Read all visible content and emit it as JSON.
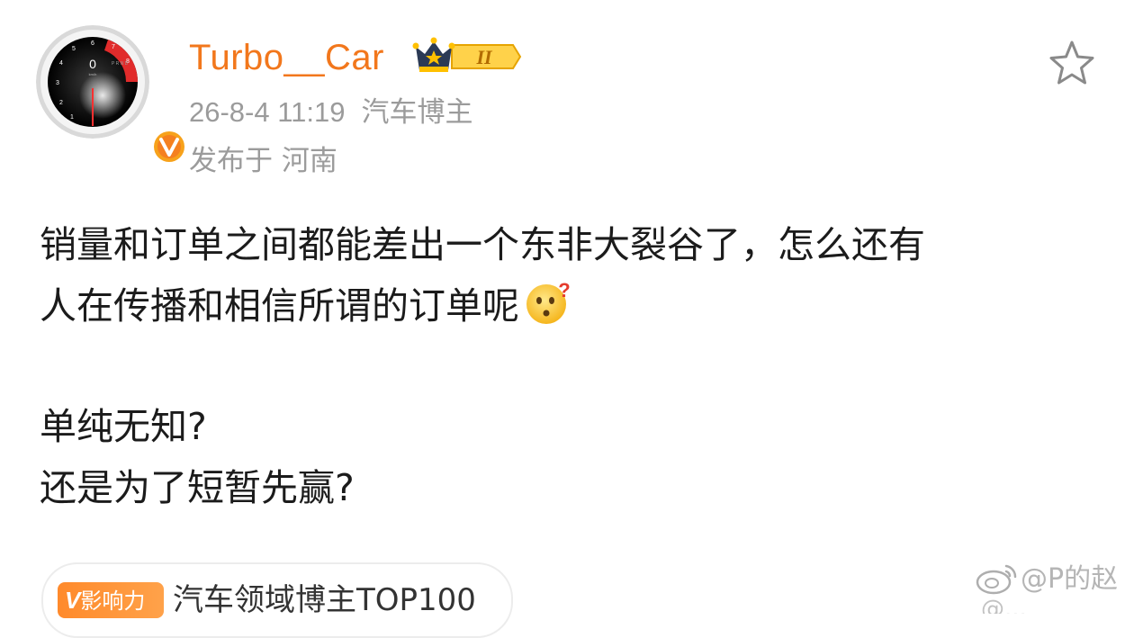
{
  "post": {
    "author": {
      "name": "Turbo__Car",
      "level": "II",
      "verified": true
    },
    "time": "26-8-4 11:19",
    "role": "汽车博主",
    "location": "发布于 河南",
    "lines": [
      "销量和订单之间都能差出一个东非大裂谷了，怎么还有",
      "人在传播和相信所谓的订单呢"
    ],
    "lines2": [
      "单纯无知?",
      "还是为了短暂先赢?"
    ],
    "emoji": "thinking-face-emoji"
  },
  "influence": {
    "tag": "影响力",
    "tag_prefix": "V",
    "text": "汽车领域博主TOP100"
  },
  "watermark": {
    "text": "@P的赵",
    "line2": "@..."
  },
  "avatar": {
    "gauge_value": "0",
    "gauge_unit": "km/h",
    "gears": "P R N D"
  },
  "colors": {
    "username": "#f2771c",
    "meta": "#9b9b9b",
    "body": "#1b1b1b",
    "badge": "#ff8a2b"
  }
}
